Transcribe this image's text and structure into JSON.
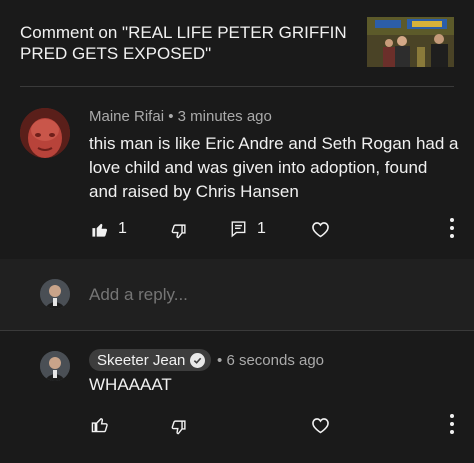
{
  "header": {
    "title": "Comment on \"REAL LIFE PETER GRIFFIN PRED GETS EXPOSED\""
  },
  "comment": {
    "author": "Maine Rifai",
    "separator": "•",
    "time": "3 minutes ago",
    "text": "this man is like Eric Andre and Seth Rogan had a love child and was given into adoption, found and raised by Chris Hansen",
    "like_count": "1",
    "reply_count": "1"
  },
  "reply_box": {
    "placeholder": "Add a reply..."
  },
  "reply": {
    "author": "Skeeter Jean",
    "separator": "•",
    "time": "6 seconds ago",
    "text": "WHAAAAT"
  },
  "icons": {
    "like": "thumbs-up-icon",
    "dislike": "thumbs-down-icon",
    "replies": "comment-icon",
    "heart": "heart-icon",
    "more": "kebab-menu-icon",
    "verified": "check-badge-icon"
  },
  "colors": {
    "background": "#1a1a1a",
    "reply_bar": "#202020",
    "secondary_text": "#aaaaaa",
    "chip": "#3d3d3d"
  }
}
